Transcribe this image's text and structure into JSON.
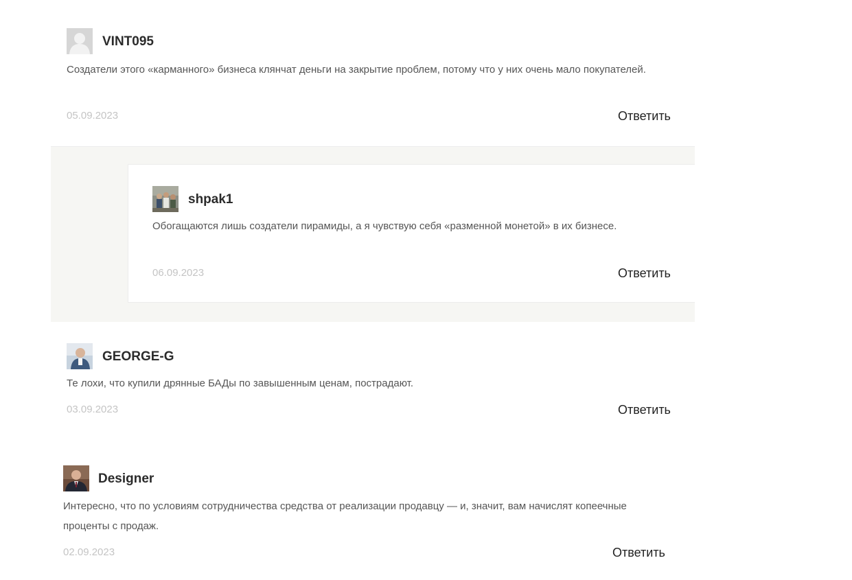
{
  "comments": [
    {
      "author": "VINT095",
      "avatar": "default-user-avatar",
      "text": "Создатели этого «карманного» бизнеса клянчат деньги на закрытие проблем, потому что у них очень мало покупателей.",
      "date": "05.09.2023",
      "reply_label": "Ответить"
    },
    {
      "author": "shpak1",
      "avatar": "group-photo-avatar",
      "text": "Обогащаются лишь создатели пирамиды, а я чувствую себя «разменной монетой» в их бизнесе.",
      "date": "06.09.2023",
      "reply_label": "Ответить"
    },
    {
      "author": "GEORGE-G",
      "avatar": "man-photo-avatar",
      "text": "Те лохи, что купили дрянные БАДы по завышенным ценам, пострадают.",
      "date": "03.09.2023",
      "reply_label": "Ответить"
    },
    {
      "author": "Designer",
      "avatar": "man-in-suit-avatar",
      "text": "Интересно, что по условиям сотрудничества средства от реализации продавцу — и, значит, вам начислят копеечные проценты с продаж.",
      "date": "02.09.2023",
      "reply_label": "Ответить"
    }
  ]
}
